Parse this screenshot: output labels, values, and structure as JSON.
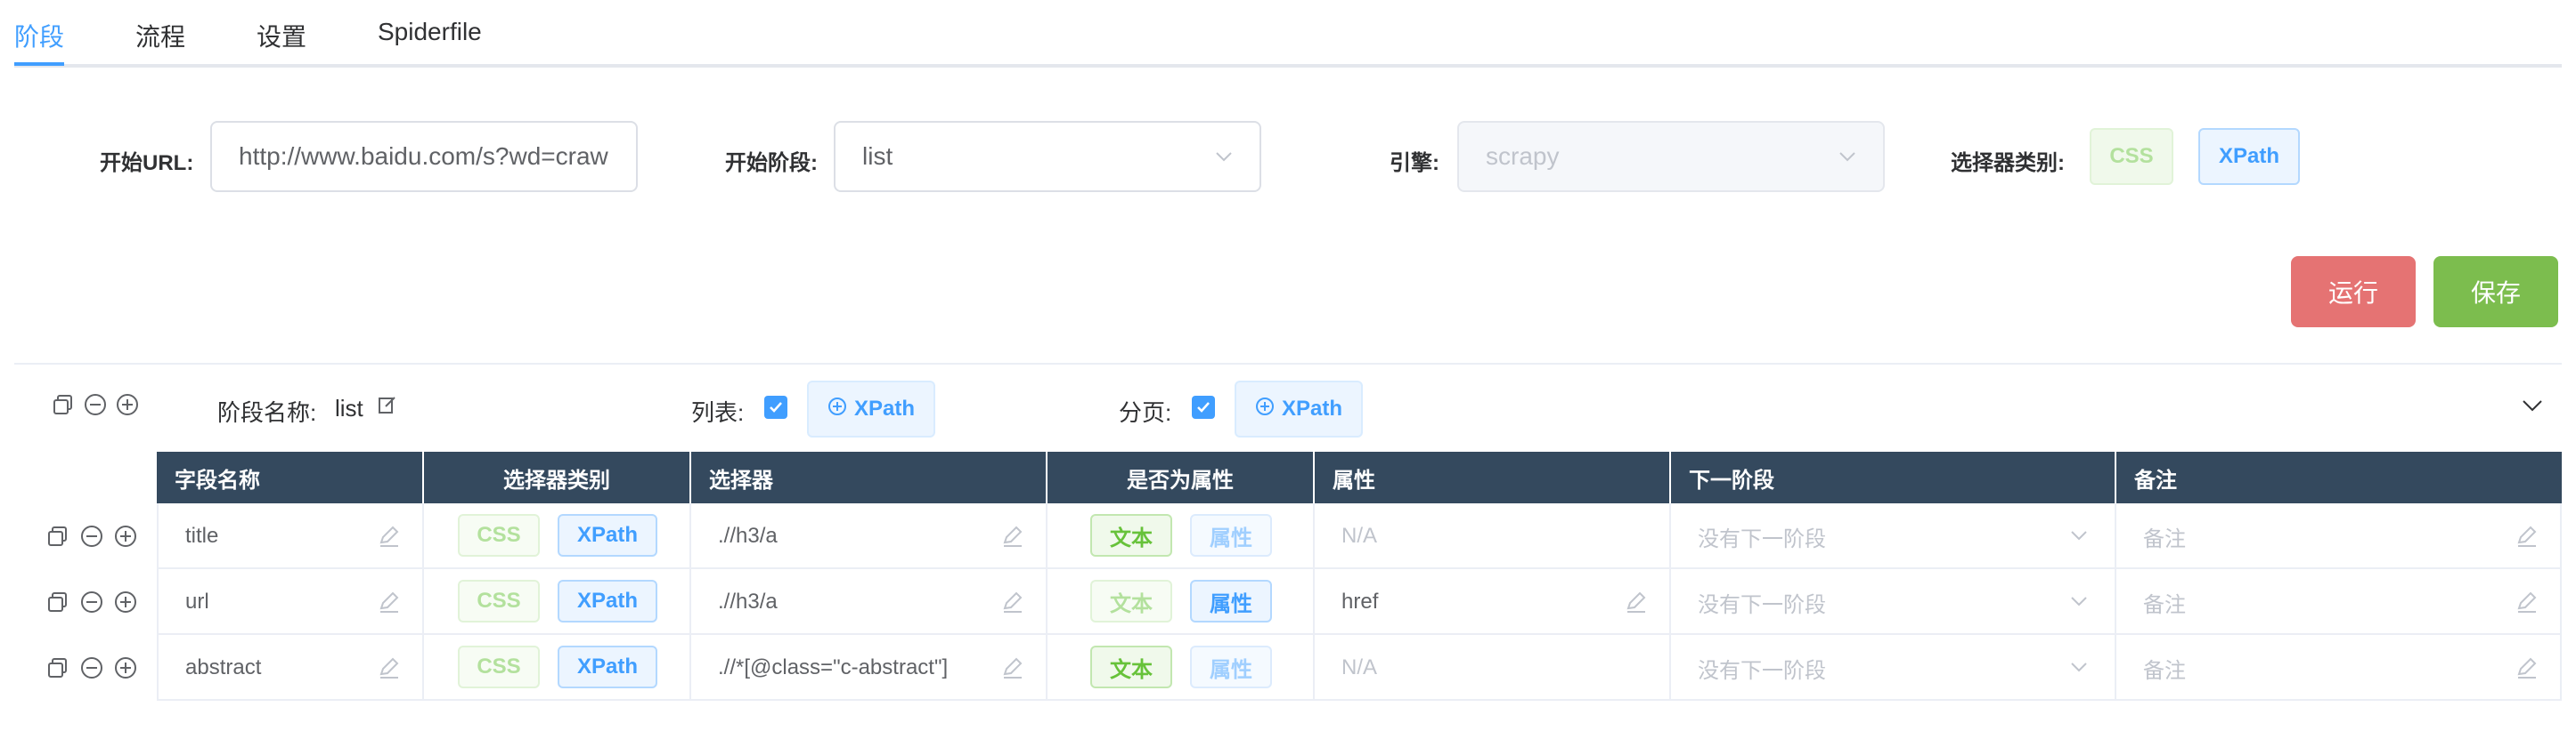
{
  "tabs": [
    {
      "label": "阶段",
      "active": true
    },
    {
      "label": "流程",
      "active": false
    },
    {
      "label": "设置",
      "active": false
    },
    {
      "label": "Spiderfile",
      "active": false
    }
  ],
  "form": {
    "start_url_label": "开始URL:",
    "start_url_value": "http://www.baidu.com/s?wd=craw",
    "start_stage_label": "开始阶段:",
    "start_stage_value": "list",
    "engine_label": "引擎:",
    "engine_value": "scrapy",
    "selector_type_label": "选择器类别:",
    "selector_css": "CSS",
    "selector_xpath": "XPath",
    "selector_active": "XPath"
  },
  "actions": {
    "run_label": "运行",
    "save_label": "保存"
  },
  "stage": {
    "name_label": "阶段名称:",
    "name_value": "list",
    "list_label": "列表:",
    "list_checked": true,
    "list_xpath": "XPath",
    "pagination_label": "分页:",
    "pagination_checked": true,
    "pagination_xpath": "XPath"
  },
  "table": {
    "headers": [
      "字段名称",
      "选择器类别",
      "选择器",
      "是否为属性",
      "属性",
      "下一阶段",
      "备注"
    ],
    "rows": [
      {
        "field": "title",
        "css": "CSS",
        "xpath": "XPath",
        "selector_type": "XPath",
        "selector": ".//h3/a",
        "text_label": "文本",
        "attr_label": "属性",
        "is_attr": false,
        "attr": "N/A",
        "next_stage": "没有下一阶段",
        "remark": "备注"
      },
      {
        "field": "url",
        "css": "CSS",
        "xpath": "XPath",
        "selector_type": "XPath",
        "selector": ".//h3/a",
        "text_label": "文本",
        "attr_label": "属性",
        "is_attr": true,
        "attr": "href",
        "next_stage": "没有下一阶段",
        "remark": "备注"
      },
      {
        "field": "abstract",
        "css": "CSS",
        "xpath": "XPath",
        "selector_type": "XPath",
        "selector": ".//*[@class=\"c-abstract\"]",
        "text_label": "文本",
        "attr_label": "属性",
        "is_attr": false,
        "attr": "N/A",
        "next_stage": "没有下一阶段",
        "remark": "备注"
      }
    ]
  },
  "colors": {
    "accent": "#409eff",
    "header_bg": "#34495e",
    "run_button": "#e57373",
    "save_button": "#7cbd4e",
    "success_text": "#67c23a"
  }
}
